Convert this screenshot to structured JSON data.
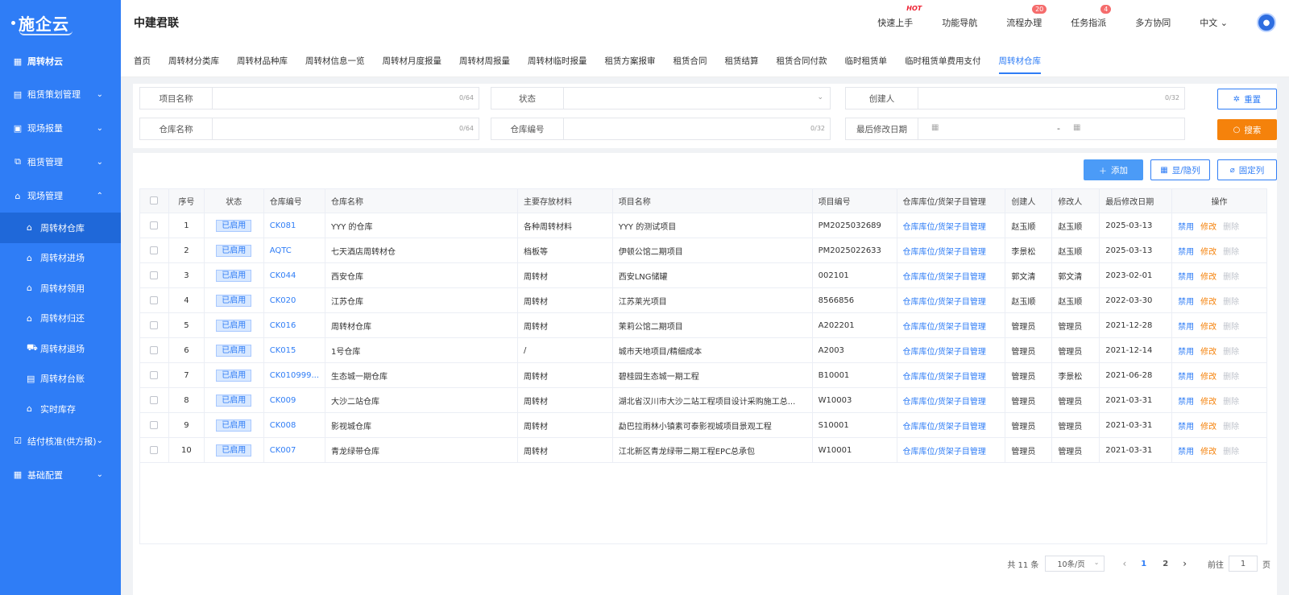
{
  "sidebar": {
    "logo": "施企云",
    "items": [
      {
        "label": "周转材云",
        "icon": "grid-icon"
      },
      {
        "label": "租赁策划管理",
        "icon": "plan-icon"
      },
      {
        "label": "现场报量",
        "icon": "report-icon"
      },
      {
        "label": "租赁管理",
        "icon": "org-icon"
      },
      {
        "label": "现场管理",
        "icon": "site-icon"
      }
    ],
    "sub_items": [
      {
        "label": "周转材仓库"
      },
      {
        "label": "周转材进场"
      },
      {
        "label": "周转材领用"
      },
      {
        "label": "周转材归还"
      },
      {
        "label": "周转材退场"
      },
      {
        "label": "周转材台账"
      },
      {
        "label": "实时库存"
      }
    ],
    "bottom_items": [
      {
        "label": "结付核准(供方报)"
      },
      {
        "label": "基础配置"
      }
    ]
  },
  "header": {
    "company": "中建君联",
    "links": {
      "quick_start": "快速上手",
      "hot": "HOT",
      "func_nav": "功能导航",
      "process": "流程办理",
      "process_count": "20",
      "task": "任务指派",
      "task_count": "4",
      "collab": "多方协同",
      "lang": "中文"
    }
  },
  "tabs": [
    "首页",
    "周转材分类库",
    "周转材品种库",
    "周转材信息一览",
    "周转材月度报量",
    "周转材周报量",
    "周转材临时报量",
    "租赁方案报审",
    "租赁合同",
    "租赁结算",
    "租赁合同付款",
    "临时租赁单",
    "临时租赁单费用支付",
    "周转材仓库"
  ],
  "filters": {
    "project_name": "项目名称",
    "project_count": "0/64",
    "status": "状态",
    "creator": "创建人",
    "creator_count": "0/32",
    "warehouse_name": "仓库名称",
    "warehouse_name_count": "0/64",
    "warehouse_no": "仓库编号",
    "warehouse_no_count": "0/32",
    "last_modified": "最后修改日期",
    "date_sep": "-",
    "reset": "重置",
    "search": "搜索"
  },
  "actions": {
    "add": "添加",
    "toggle": "显/隐列",
    "fix": "固定列"
  },
  "table": {
    "headers": [
      "序号",
      "状态",
      "仓库编号",
      "仓库名称",
      "主要存放材料",
      "项目名称",
      "项目编号",
      "仓库库位/货架子目管理",
      "创建人",
      "修改人",
      "最后修改日期",
      "操作"
    ],
    "rows": [
      {
        "no": "1",
        "status": "已启用",
        "code": "CK081",
        "name": "YYY 的仓库",
        "material": "各种周转材料",
        "project": "YYY 的测试项目",
        "project_no": "PM2025032689",
        "manage": "仓库库位/货架子目管理",
        "creator": "赵玉顺",
        "modifier": "赵玉顺",
        "date": "2025-03-13"
      },
      {
        "no": "2",
        "status": "已启用",
        "code": "AQTC",
        "name": "七天酒店周转材仓",
        "material": "档板等",
        "project": "伊顿公馆二期项目",
        "project_no": "PM2025022633",
        "manage": "仓库库位/货架子目管理",
        "creator": "李景松",
        "modifier": "赵玉顺",
        "date": "2025-03-13"
      },
      {
        "no": "3",
        "status": "已启用",
        "code": "CK044",
        "name": "西安仓库",
        "material": "周转材",
        "project": "西安LNG储罐",
        "project_no": "002101",
        "manage": "仓库库位/货架子目管理",
        "creator": "郭文清",
        "modifier": "郭文清",
        "date": "2023-02-01"
      },
      {
        "no": "4",
        "status": "已启用",
        "code": "CK020",
        "name": "江苏仓库",
        "material": "周转材",
        "project": "江苏莱光项目",
        "project_no": "8566856",
        "manage": "仓库库位/货架子目管理",
        "creator": "赵玉顺",
        "modifier": "赵玉顺",
        "date": "2022-03-30"
      },
      {
        "no": "5",
        "status": "已启用",
        "code": "CK016",
        "name": "周转材仓库",
        "material": "周转材",
        "project": "茉莉公馆二期项目",
        "project_no": "A202201",
        "manage": "仓库库位/货架子目管理",
        "creator": "管理员",
        "modifier": "管理员",
        "date": "2021-12-28"
      },
      {
        "no": "6",
        "status": "已启用",
        "code": "CK015",
        "name": "1号仓库",
        "material": "/",
        "project": "城市天地项目/精细成本",
        "project_no": "A2003",
        "manage": "仓库库位/货架子目管理",
        "creator": "管理员",
        "modifier": "管理员",
        "date": "2021-12-14"
      },
      {
        "no": "7",
        "status": "已启用",
        "code": "CK010999...",
        "name": "生态城一期仓库",
        "material": "周转材",
        "project": "碧桂园生态城一期工程",
        "project_no": "B10001",
        "manage": "仓库库位/货架子目管理",
        "creator": "管理员",
        "modifier": "李景松",
        "date": "2021-06-28"
      },
      {
        "no": "8",
        "status": "已启用",
        "code": "CK009",
        "name": "大沙二站仓库",
        "material": "周转材",
        "project": "湖北省汉川市大沙二站工程项目设计采购施工总...",
        "project_no": "W10003",
        "manage": "仓库库位/货架子目管理",
        "creator": "管理员",
        "modifier": "管理员",
        "date": "2021-03-31"
      },
      {
        "no": "9",
        "status": "已启用",
        "code": "CK008",
        "name": "影视城仓库",
        "material": "周转材",
        "project": "勐巴拉雨林小镇素可泰影视城项目景观工程",
        "project_no": "S10001",
        "manage": "仓库库位/货架子目管理",
        "creator": "管理员",
        "modifier": "管理员",
        "date": "2021-03-31"
      },
      {
        "no": "10",
        "status": "已启用",
        "code": "CK007",
        "name": "青龙绿带仓库",
        "material": "周转材",
        "project": "江北新区青龙绿带二期工程EPC总承包",
        "project_no": "W10001",
        "manage": "仓库库位/货架子目管理",
        "creator": "管理员",
        "modifier": "管理员",
        "date": "2021-03-31"
      }
    ],
    "ops": {
      "disable": "禁用",
      "modify": "修改",
      "delete": "删除"
    }
  },
  "pagination": {
    "total": "共 11 条",
    "page_size": "10条/页",
    "pages": [
      "1",
      "2"
    ],
    "goto_label": "前往",
    "goto_value": "1",
    "goto_suffix": "页"
  }
}
